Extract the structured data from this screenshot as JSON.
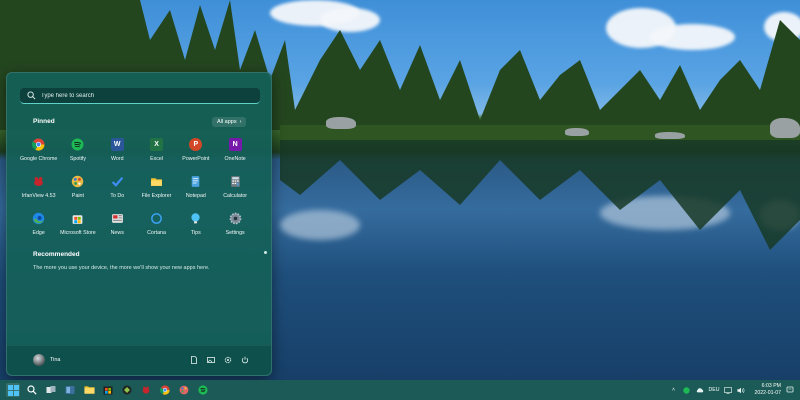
{
  "start_menu": {
    "search_placeholder": "Type here to search",
    "pinned_title": "Pinned",
    "all_apps_label": "All apps",
    "pinned_apps": [
      {
        "label": "Google Chrome",
        "icon": "chrome-icon"
      },
      {
        "label": "Spotify",
        "icon": "spotify-icon"
      },
      {
        "label": "Word",
        "icon": "word-icon"
      },
      {
        "label": "Excel",
        "icon": "excel-icon"
      },
      {
        "label": "PowerPoint",
        "icon": "powerpoint-icon"
      },
      {
        "label": "OneNote",
        "icon": "onenote-icon"
      },
      {
        "label": "IrfanView 4.53",
        "icon": "irfanview-icon"
      },
      {
        "label": "Paint",
        "icon": "paint-icon"
      },
      {
        "label": "To Do",
        "icon": "todo-icon"
      },
      {
        "label": "File Explorer",
        "icon": "folder-icon"
      },
      {
        "label": "Notepad",
        "icon": "notepad-icon"
      },
      {
        "label": "Calculator",
        "icon": "calculator-icon"
      },
      {
        "label": "Edge",
        "icon": "edge-icon"
      },
      {
        "label": "Microsoft Store",
        "icon": "store-icon"
      },
      {
        "label": "News",
        "icon": "news-icon"
      },
      {
        "label": "Cortana",
        "icon": "cortana-icon"
      },
      {
        "label": "Tips",
        "icon": "tips-icon"
      },
      {
        "label": "Settings",
        "icon": "settings-icon"
      }
    ],
    "recommended_title": "Recommended",
    "recommended_text": "The more you use your device, the more we'll show your new apps here.",
    "user_name": "Tina"
  },
  "taskbar": {
    "language": "DEU",
    "time": "6:03 PM",
    "date": "2022-01-07"
  },
  "colors": {
    "menu_bg": "#146058",
    "taskbar_bg": "#1b5a56",
    "search_accent": "#5fd3c6"
  }
}
